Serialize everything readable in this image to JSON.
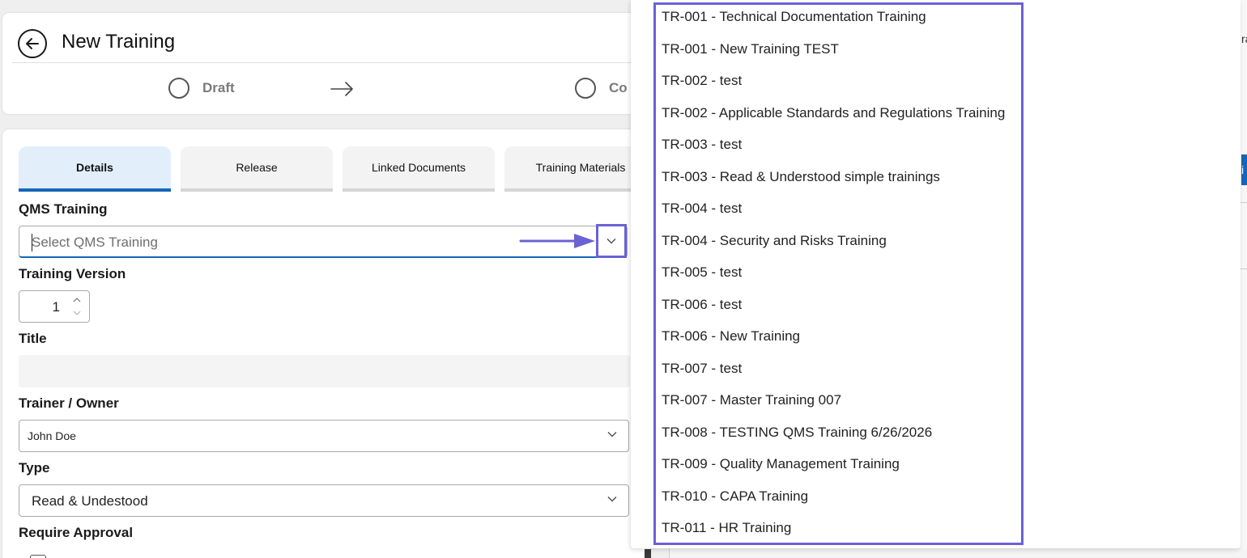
{
  "header": {
    "title": "New Training",
    "steps": [
      {
        "label": "Draft"
      },
      {
        "label": "Co"
      }
    ]
  },
  "tabs": [
    {
      "label": "Details",
      "active": true
    },
    {
      "label": "Release",
      "active": false
    },
    {
      "label": "Linked Documents",
      "active": false
    },
    {
      "label": "Training Materials",
      "active": false
    }
  ],
  "form": {
    "qms_training": {
      "label": "QMS Training",
      "placeholder": "Select QMS Training"
    },
    "training_version": {
      "label": "Training Version",
      "value": "1"
    },
    "title": {
      "label": "Title",
      "value": ""
    },
    "trainer_owner": {
      "label": "Trainer / Owner",
      "value": "John Doe"
    },
    "type": {
      "label": "Type",
      "value": "Read & Undestood"
    },
    "require_approval": {
      "label": "Require Approval"
    }
  },
  "qms_options": [
    "TR-001 - Technical Documentation Training",
    "TR-001 - New Training TEST",
    "TR-002 - test",
    "TR-002 - Applicable Standards and Regulations Training",
    "TR-003 - test",
    "TR-003 - Read & Understood simple trainings",
    "TR-004 - test",
    "TR-004 - Security and Risks Training",
    "TR-005 - test",
    "TR-006 - test",
    "TR-006 - New Training",
    "TR-007 - test",
    "TR-007 - Master Training 007",
    "TR-008 - TESTING QMS Training 6/26/2026",
    "TR-009 - Quality Management Training",
    "TR-010 - CAPA Training",
    "TR-011 - HR Training"
  ],
  "right_edge": {
    "text_top": "ra",
    "button_text": "i"
  },
  "colors": {
    "accent": "#1466b8",
    "annotation": "#6b62d4",
    "active_tab_bg": "#e3eefb"
  },
  "icons": {
    "back": "arrow-left-circle-icon",
    "step": "circle-icon",
    "arrow": "arrow-right-icon",
    "chevron": "chevron-down-icon"
  }
}
